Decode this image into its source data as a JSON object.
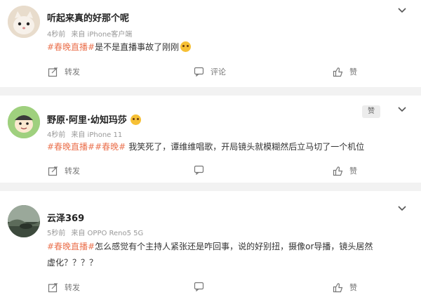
{
  "comments": [
    {
      "username": "听起来真的好那个呢",
      "time": "4秒前",
      "source": "来自 iPhone客户端",
      "tags": "#春晚直播#",
      "text": "是不是直播事故了刚刚",
      "emoji_icon": "crying-laughing-emoji-icon",
      "action_forward": "转发",
      "action_comment": "评论",
      "action_like": "赞"
    },
    {
      "username": "野原·阿里·幼知玛莎",
      "time": "4秒前",
      "source": "来自 iPhone 11",
      "tags": "#春晚直播##春晚#",
      "text": "我笑死了，谭维维唱歌，开局镜头就模糊然后立马切了一个机位",
      "emoji_icon": "laughing-emoji-icon",
      "badge": "赞",
      "action_forward": "转发",
      "action_like": "赞"
    },
    {
      "username": "云泽369",
      "time": "5秒前",
      "source": "来自 OPPO Reno5 5G",
      "tags": "#春晚直播#",
      "text_line1": "怎么感觉有个主持人紧张还是咋回事，说的好别扭，摄像or导播，镜头居然",
      "text_line2": "虚化？？？？",
      "action_forward": "转发",
      "action_like": "赞"
    }
  ],
  "colors": {
    "tag": "#eb7350",
    "background": "#f2f2f2",
    "card": "#ffffff"
  }
}
